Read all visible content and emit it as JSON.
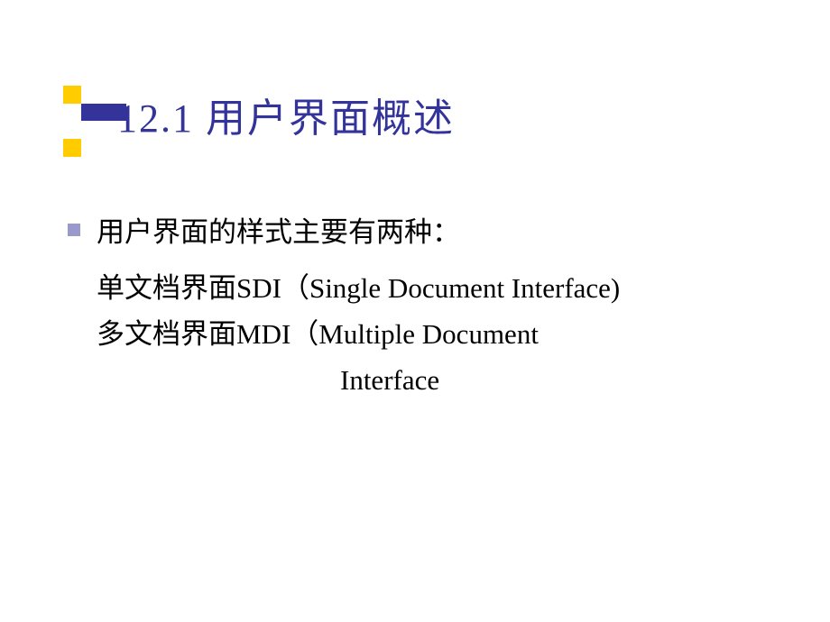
{
  "slide": {
    "title": "12.1 用户界面概述",
    "bullet1": "用户界面的样式主要有两种：",
    "line1_cn": "单文档界面",
    "line1_en": "SDI（Single Document Interface)",
    "line2_cn": "多文档界面",
    "line2_en": "MDI（Multiple Document",
    "line3": "Interface"
  }
}
